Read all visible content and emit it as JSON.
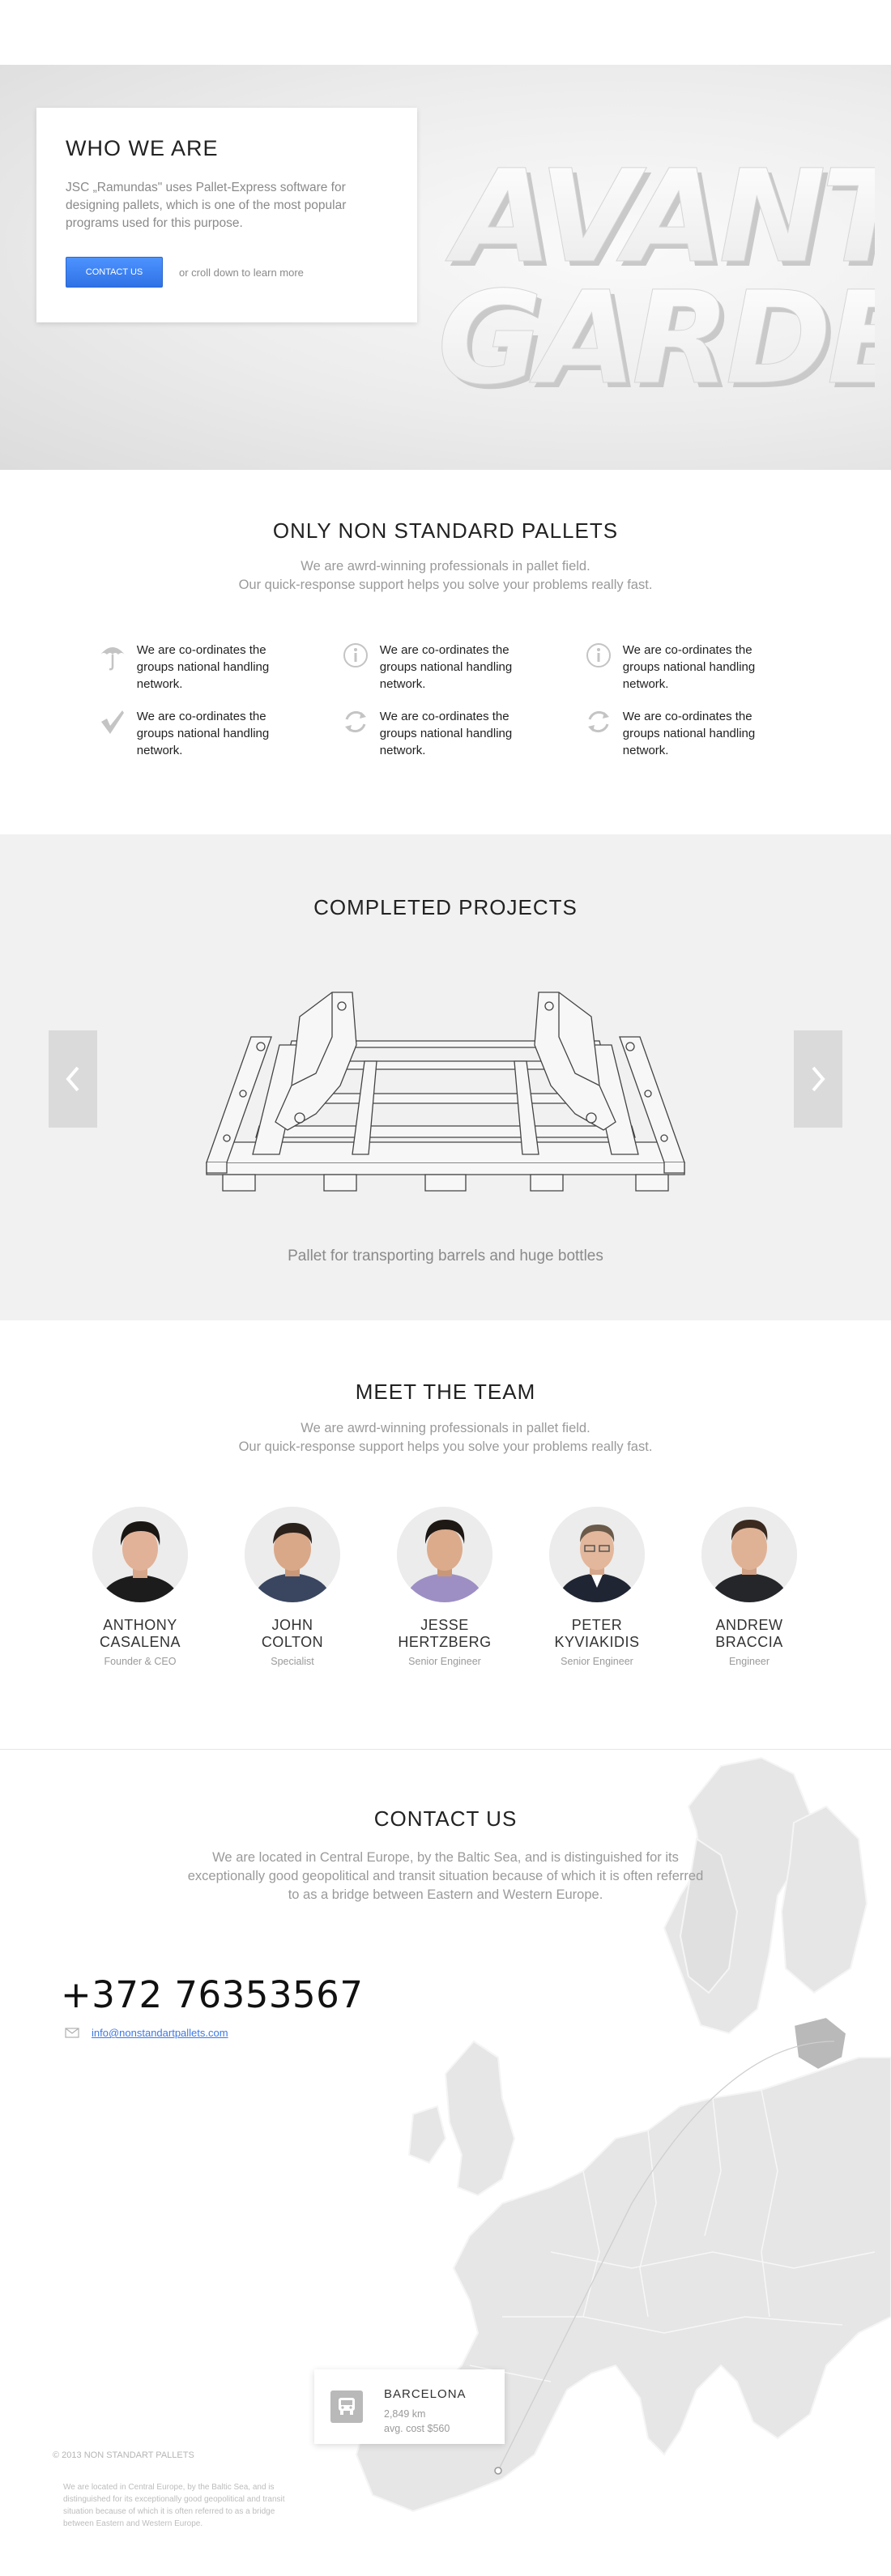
{
  "hero": {
    "title": "WHO WE ARE",
    "text": "JSC „Ramundas\" uses Pallet-Express software for designing pallets, which is one of the most popular programs used for this purpose.",
    "contact_button": "CONTACT US",
    "scroll_hint": "or croll down to learn more",
    "art_text_line1": "AVANT",
    "art_text_line2": "GARDE",
    "accent": "#3b82f6"
  },
  "features": {
    "title": "ONLY NON STANDARD PALLETS",
    "subtitle_line1": "We are awrd-winning professionals in pallet field.",
    "subtitle_line2": "Our quick-response support helps you solve your problems really fast.",
    "items": [
      {
        "icon": "umbrella-icon",
        "text": "We are co-ordinates the groups national handling network."
      },
      {
        "icon": "info-icon",
        "text": "We are co-ordinates the groups national handling network."
      },
      {
        "icon": "info-icon",
        "text": "We are co-ordinates the groups national handling network."
      },
      {
        "icon": "checkmark-icon",
        "text": "We are co-ordinates the groups national handling network."
      },
      {
        "icon": "refresh-icon",
        "text": "We are co-ordinates the groups national handling network."
      },
      {
        "icon": "refresh-icon",
        "text": "We are co-ordinates the groups national handling network."
      }
    ]
  },
  "projects": {
    "title": "COMPLETED PROJECTS",
    "caption": "Pallet for transporting barrels and huge bottles"
  },
  "team": {
    "title": "MEET THE TEAM",
    "subtitle_line1": "We are awrd-winning professionals in pallet field.",
    "subtitle_line2": "Our quick-response support helps you solve your problems really fast.",
    "members": [
      {
        "first": "ANTHONY",
        "last": "CASALENA",
        "role": "Founder & CEO"
      },
      {
        "first": "JOHN",
        "last": "COLTON",
        "role": "Specialist"
      },
      {
        "first": "JESSE",
        "last": "HERTZBERG",
        "role": "Senior Engineer"
      },
      {
        "first": "PETER",
        "last": "KYVIAKIDIS",
        "role": "Senior Engineer"
      },
      {
        "first": "ANDREW",
        "last": "BRACCIA",
        "role": "Engineer"
      }
    ]
  },
  "contact": {
    "title": "CONTACT US",
    "text": "We are located in Central Europe, by the Baltic Sea, and is distinguished for its exceptionally good geopolitical and transit situation because of which it is often referred to as a bridge between Eastern and Western Europe.",
    "phone": "+372 76353567",
    "email": "info@nonstandartpallets.com",
    "popup": {
      "city": "BARCELONA",
      "distance": "2,849 km",
      "cost": "avg. cost $560"
    },
    "copyright": "© 2013 NON STANDART PALLETS",
    "footer_text": "We are located in Central Europe, by the Baltic Sea, and is distinguished for its exceptionally good geopolitical and transit situation because of which it is often referred to as a bridge between Eastern and Western Europe."
  }
}
